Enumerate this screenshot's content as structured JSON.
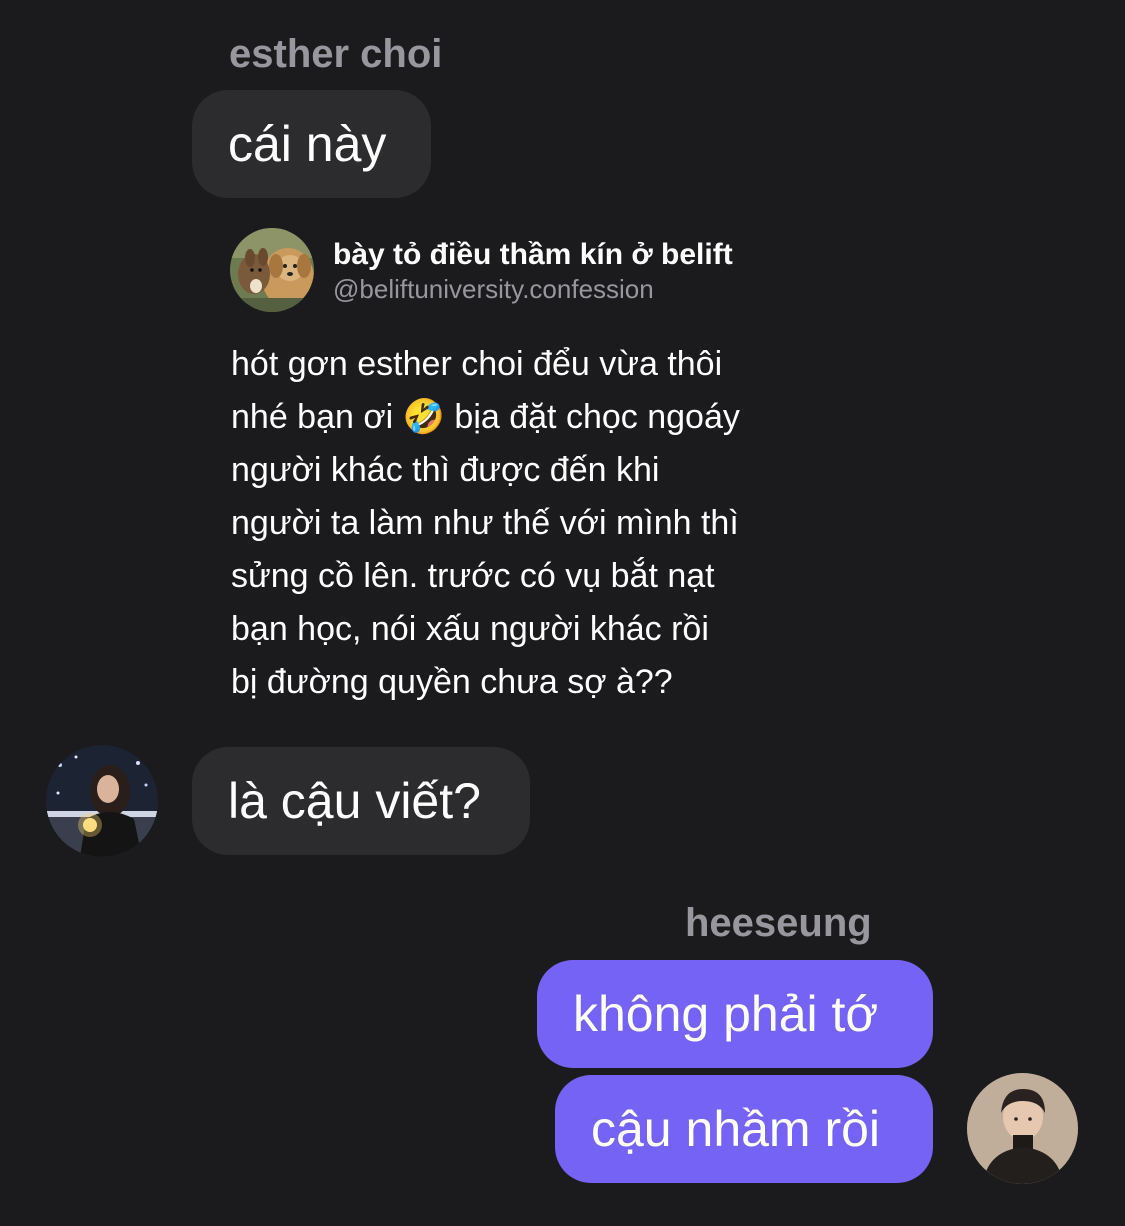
{
  "thread": {
    "sender_top": "esther choi",
    "msg_1": "cái này",
    "shared_post": {
      "display_name": "bày tỏ điều thầm kín ở belift",
      "handle": "@beliftuniversity.confession",
      "lines": [
        "hót gơn esther choi đểu vừa thôi",
        "nhé bạn ơi 🤣 bịa đặt chọc ngoáy",
        "người khác thì được đến khi",
        "người ta làm như thế với mình thì",
        "sửng cồ lên. trước có vụ bắt nạt",
        "bạn học, nói xấu người khác rồi",
        "bị đường quyền chưa sợ à??"
      ]
    },
    "msg_2": "là cậu viết?",
    "sender_bottom": "heeseung",
    "reply_1": "không phải tớ",
    "reply_2": "cậu nhầm rồi"
  },
  "colors": {
    "background": "#1b1b1d",
    "incoming_bubble": "#2c2c2e",
    "outgoing_bubble": "#7563f5",
    "name_gray": "#98979d"
  },
  "icons": {
    "post_avatar": "dog-deer-photo-avatar",
    "esther_avatar": "girl-night-photo-avatar",
    "heeseung_avatar": "boy-portrait-photo-avatar"
  }
}
